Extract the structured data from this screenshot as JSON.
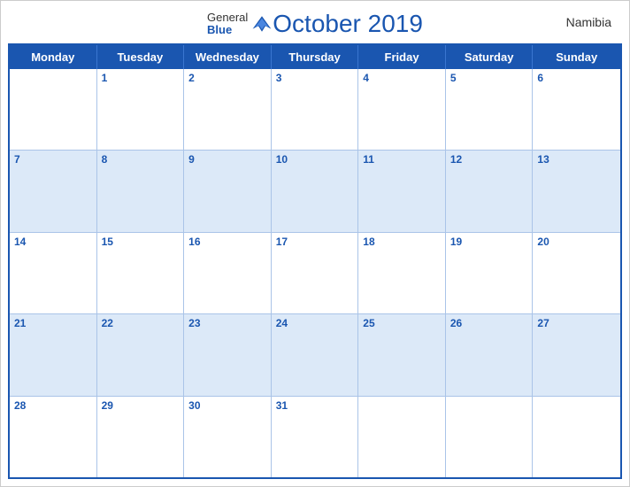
{
  "header": {
    "title": "October 2019",
    "country": "Namibia",
    "logo": {
      "general": "General",
      "blue": "Blue"
    }
  },
  "dayHeaders": [
    "Monday",
    "Tuesday",
    "Wednesday",
    "Thursday",
    "Friday",
    "Saturday",
    "Sunday"
  ],
  "weeks": [
    [
      {
        "num": "",
        "empty": true
      },
      {
        "num": "1"
      },
      {
        "num": "2"
      },
      {
        "num": "3"
      },
      {
        "num": "4"
      },
      {
        "num": "5"
      },
      {
        "num": "6"
      }
    ],
    [
      {
        "num": "7"
      },
      {
        "num": "8"
      },
      {
        "num": "9"
      },
      {
        "num": "10"
      },
      {
        "num": "11"
      },
      {
        "num": "12"
      },
      {
        "num": "13"
      }
    ],
    [
      {
        "num": "14"
      },
      {
        "num": "15"
      },
      {
        "num": "16"
      },
      {
        "num": "17"
      },
      {
        "num": "18"
      },
      {
        "num": "19"
      },
      {
        "num": "20"
      }
    ],
    [
      {
        "num": "21"
      },
      {
        "num": "22"
      },
      {
        "num": "23"
      },
      {
        "num": "24"
      },
      {
        "num": "25"
      },
      {
        "num": "26"
      },
      {
        "num": "27"
      }
    ],
    [
      {
        "num": "28"
      },
      {
        "num": "29"
      },
      {
        "num": "30"
      },
      {
        "num": "31"
      },
      {
        "num": "",
        "empty": true
      },
      {
        "num": "",
        "empty": true
      },
      {
        "num": "",
        "empty": true
      }
    ]
  ]
}
